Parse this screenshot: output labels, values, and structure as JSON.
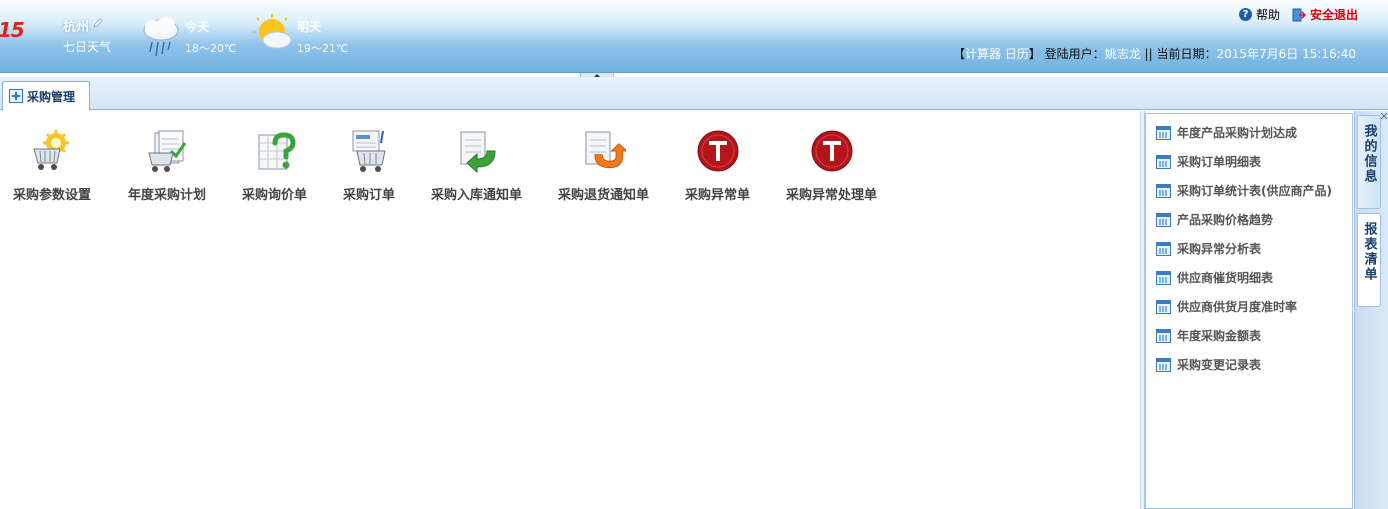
{
  "header": {
    "logo_fragment": "15",
    "city": "杭州",
    "seven_day": "七日天气",
    "today": {
      "label": "今天",
      "temp": "18～20℃",
      "icon": "rain-cloud-icon"
    },
    "tomorrow": {
      "label": "明天",
      "temp": "19～21℃",
      "icon": "sun-cloud-icon"
    },
    "help": "帮助",
    "exit": "安全退出",
    "tools_open": "【",
    "calculator": "计算器",
    "calendar": "日历",
    "tools_close": "】",
    "login_label": "登陆用户：",
    "user": "姚志龙",
    "separator": "||",
    "date_label": "当前日期：",
    "date_value": "2015年7月6日 15:16:40"
  },
  "tabs": [
    {
      "label": "采购管理",
      "active": true
    }
  ],
  "functions": [
    {
      "label": "采购参数设置",
      "icon": "cart-settings-icon"
    },
    {
      "label": "年度采购计划",
      "icon": "cart-plan-icon"
    },
    {
      "label": "采购询价单",
      "icon": "inquiry-question-icon"
    },
    {
      "label": "采购订单",
      "icon": "cart-order-icon"
    },
    {
      "label": "采购入库通知单",
      "icon": "inbound-arrow-icon"
    },
    {
      "label": "采购退货通知单",
      "icon": "return-arrow-icon"
    },
    {
      "label": "采购异常单",
      "icon": "exception-icon"
    },
    {
      "label": "采购异常处理单",
      "icon": "exception-handle-icon"
    }
  ],
  "reports": [
    {
      "label": "年度产品采购计划达成"
    },
    {
      "label": "采购订单明细表"
    },
    {
      "label": "采购订单统计表(供应商产品)"
    },
    {
      "label": "产品采购价格趋势"
    },
    {
      "label": "采购异常分析表"
    },
    {
      "label": "供应商催货明细表"
    },
    {
      "label": "供应商供货月度准时率"
    },
    {
      "label": "年度采购金额表"
    },
    {
      "label": "采购变更记录表"
    }
  ],
  "side_tabs": [
    {
      "label": "我的信息",
      "active": false
    },
    {
      "label": "报表清单",
      "active": true
    }
  ],
  "colors": {
    "accent": "#2b78c7",
    "exit": "#e00000",
    "exception": "#b3151b"
  }
}
